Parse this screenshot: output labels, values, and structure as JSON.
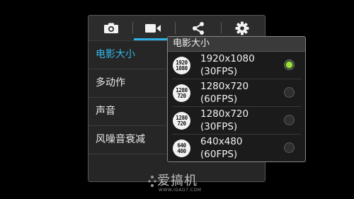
{
  "tabs": [
    {
      "icon": "camera-icon"
    },
    {
      "icon": "video-camera-icon"
    },
    {
      "icon": "share-icon"
    },
    {
      "icon": "gear-icon"
    }
  ],
  "menu": {
    "items": [
      {
        "label": "电影大小"
      },
      {
        "label": "多动作"
      },
      {
        "label": "声音"
      },
      {
        "label": "风噪音衰减"
      }
    ]
  },
  "popup": {
    "title": "电影大小",
    "options": [
      {
        "icon_top": "1920",
        "icon_bottom": "1080",
        "resolution": "1920x1080",
        "fps": "(30FPS)",
        "selected": true
      },
      {
        "icon_top": "1280",
        "icon_bottom": "720",
        "resolution": "1280x720",
        "fps": "(60FPS)",
        "selected": false
      },
      {
        "icon_top": "1280",
        "icon_bottom": "720",
        "resolution": "1280x720",
        "fps": "(30FPS)",
        "selected": false
      },
      {
        "icon_top": "640",
        "icon_bottom": "480",
        "resolution": "640x480",
        "fps": "(60FPS)",
        "selected": false
      }
    ]
  },
  "watermark": {
    "text": "爱搞机",
    "url": "WWW.IGAO7.COM"
  },
  "colors": {
    "accent": "#33b5e5",
    "radio_selected": "#9be03a"
  }
}
